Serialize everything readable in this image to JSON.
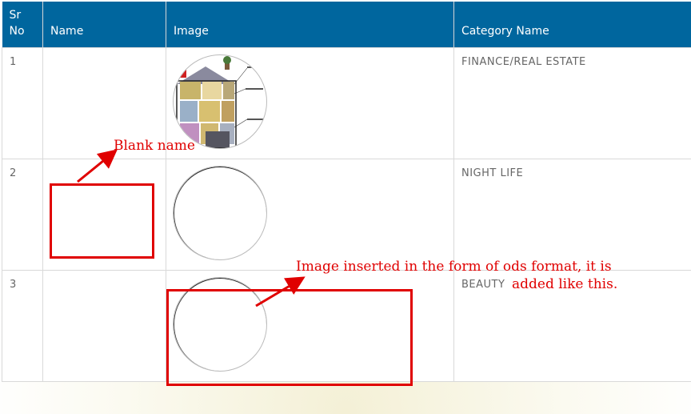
{
  "table": {
    "headers": [
      "Sr\nNo",
      "Name",
      "Image",
      "Category Name"
    ],
    "rows": [
      {
        "sr": "1",
        "name": "",
        "image": "house-cutaway-illustration",
        "category": "FINANCE/REAL ESTATE"
      },
      {
        "sr": "2",
        "name": "",
        "image": "blank-circle",
        "category": "NIGHT LIFE"
      },
      {
        "sr": "3",
        "name": "",
        "image": "blank-circle",
        "category": "BEAUTY"
      }
    ]
  },
  "annotations": {
    "blank_name": "Blank name",
    "image_note_line1": "Image inserted in the form of ods format, it is",
    "image_note_line2": "added like this."
  },
  "colors": {
    "header_bg": "#00669e",
    "annotation": "#e00000"
  }
}
